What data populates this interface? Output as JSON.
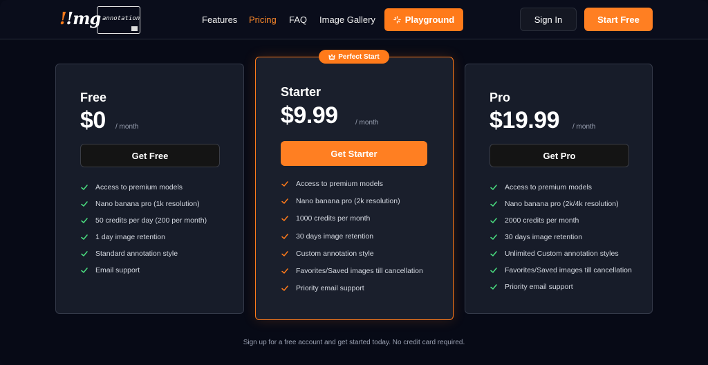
{
  "brand": {
    "mark": "!mg",
    "tagline": "annotation"
  },
  "nav": {
    "features": "Features",
    "pricing": "Pricing",
    "faq": "FAQ",
    "gallery": "Image Gallery",
    "playground": "Playground",
    "sign_in": "Sign In",
    "start_free": "Start Free"
  },
  "colors": {
    "accent": "#ff7a1a",
    "check": "#4ade80",
    "check_featured": "#ff7a1a"
  },
  "badge": "Perfect Start",
  "plans": [
    {
      "name": "Free",
      "price": "$0",
      "period": "/ month",
      "cta": "Get Free",
      "features": [
        "Access to premium models",
        "Nano banana pro (1k resolution)",
        "50 credits per day (200 per month)",
        "1 day image retention",
        "Standard annotation style",
        "Email support"
      ]
    },
    {
      "name": "Starter",
      "price": "$9.99",
      "period": "/ month",
      "cta": "Get Starter",
      "features": [
        "Access to premium models",
        "Nano banana pro (2k resolution)",
        "1000 credits per month",
        "30 days image retention",
        "Custom annotation style",
        "Favorites/Saved images till cancellation",
        "Priority email support"
      ]
    },
    {
      "name": "Pro",
      "price": "$19.99",
      "period": "/ month",
      "cta": "Get Pro",
      "features": [
        "Access to premium models",
        "Nano banana pro (2k/4k resolution)",
        "2000 credits per month",
        "30 days image retention",
        "Unlimited Custom annotation styles",
        "Favorites/Saved images till cancellation",
        "Priority email support"
      ]
    }
  ],
  "footer_note": "Sign up for a free account and get started today. No credit card required."
}
